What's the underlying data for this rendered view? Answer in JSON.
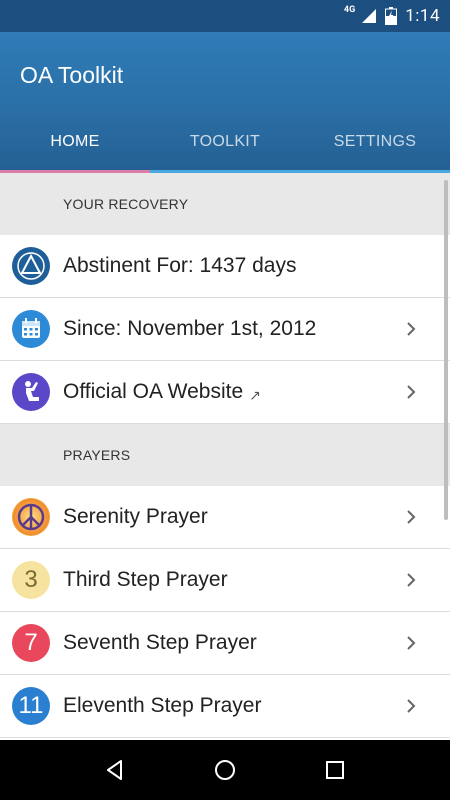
{
  "status_bar": {
    "network": "4G",
    "time": "1:14"
  },
  "app": {
    "title": "OA Toolkit"
  },
  "tabs": [
    {
      "label": "HOME",
      "active": true
    },
    {
      "label": "TOOLKIT",
      "active": false
    },
    {
      "label": "SETTINGS",
      "active": false
    }
  ],
  "sections": {
    "recovery": {
      "header": "YOUR RECOVERY",
      "items": [
        {
          "label": "Abstinent For: 1437 days",
          "icon": "oa-triangle-icon",
          "chevron": false
        },
        {
          "label": "Since: November 1st, 2012",
          "icon": "calendar-icon",
          "chevron": true
        },
        {
          "label": "Official OA Website",
          "icon": "praying-person-icon",
          "chevron": true,
          "external": "↗"
        }
      ]
    },
    "prayers": {
      "header": "PRAYERS",
      "items": [
        {
          "label": "Serenity Prayer",
          "icon": "peace-sign-icon"
        },
        {
          "label": "Third Step Prayer",
          "icon": "number-3-icon",
          "number": "3"
        },
        {
          "label": "Seventh Step Prayer",
          "icon": "number-7-icon",
          "number": "7"
        },
        {
          "label": "Eleventh Step Prayer",
          "icon": "number-11-icon",
          "number": "11"
        }
      ]
    }
  },
  "colors": {
    "status_bar": "#1c4f7f",
    "app_bar": "#2a6fa6",
    "tab_indicator": "#d87fa8",
    "section_bg": "#e8e8e8"
  }
}
